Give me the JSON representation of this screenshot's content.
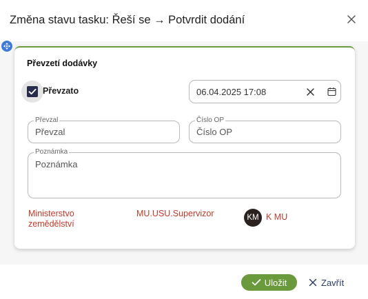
{
  "dialog": {
    "title": "Změna stavu tasku: Řeší se → Potvrdit dodání",
    "close_icon": "close-icon"
  },
  "card": {
    "title": "Převzetí dodávky",
    "accent_color": "#6a9a3c",
    "checkbox": {
      "label": "Převzato",
      "checked": true
    },
    "datetime": {
      "value": "06.04.2025 17:08"
    },
    "prevzal": {
      "label": "Převzal",
      "placeholder": "Převzal"
    },
    "cislo_op": {
      "label": "Číslo OP",
      "placeholder": "Číslo OP"
    },
    "poznamka": {
      "label": "Poznámka",
      "placeholder": "Poznámka"
    },
    "info": {
      "organization_line1": "Ministerstvo",
      "organization_line2": "zemědělství",
      "role": "MU.USU.Supervizor",
      "avatar_initials": "KM",
      "user": "K MU"
    }
  },
  "footer": {
    "save_label": "Uložit",
    "close_label": "Zavřít",
    "save_color": "#6a9a3c"
  }
}
